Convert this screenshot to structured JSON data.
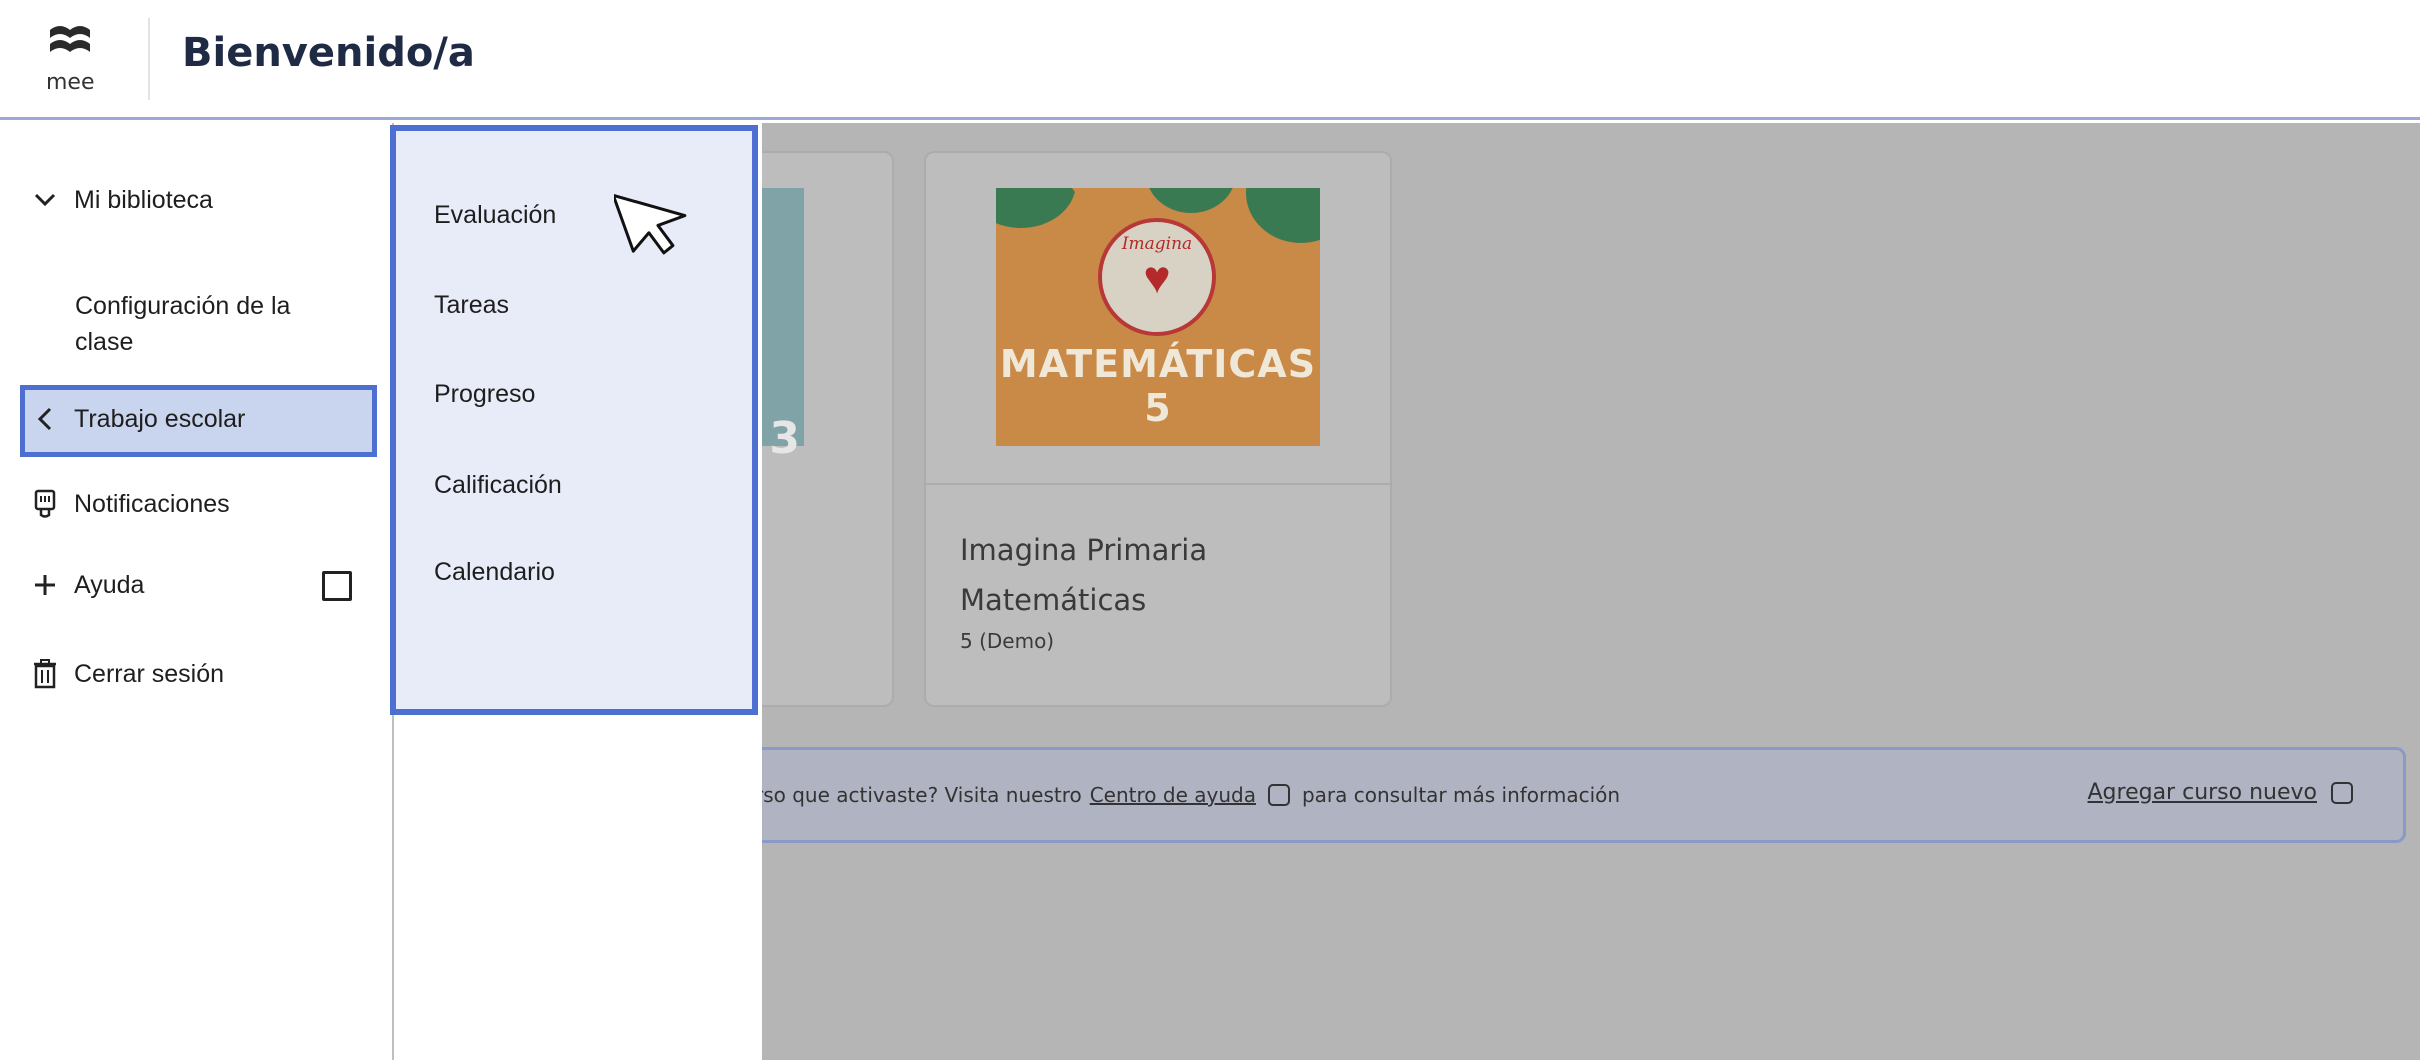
{
  "header": {
    "logo_text": "mee",
    "title": "Bienvenido/a"
  },
  "sidebar": {
    "items": [
      {
        "label": "Mi biblioteca",
        "icon": "chevron-down-icon"
      },
      {
        "label": "Configuración de la clase"
      },
      {
        "label": "Trabajo escolar",
        "icon": "chevron-left-icon"
      },
      {
        "label": "Notificaciones",
        "icon": "bell-icon"
      },
      {
        "label": "Ayuda",
        "icon": "plus-icon"
      },
      {
        "label": "Cerrar sesión",
        "icon": "trash-icon"
      }
    ]
  },
  "submenu": {
    "items": [
      "Evaluación",
      "Tareas",
      "Progreso",
      "Calificación",
      "Calendario"
    ]
  },
  "courses": [
    {
      "cover_text": "3"
    },
    {
      "cover_title": "MATEMÁTICAS 5",
      "cover_badge": "Imagina",
      "name": "Imagina Primaria Matemáticas",
      "level": "5 (Demo)"
    }
  ],
  "info_bar": {
    "text_before": "rso que activaste? Visita nuestro",
    "link": "Centro de ayuda",
    "text_after": "para consultar más información",
    "add_course": "Agregar curso nuevo"
  },
  "colors": {
    "highlight_border": "#4c6fd1",
    "active_bg": "#c9d4ee",
    "overlay": "#b5b5b5"
  }
}
